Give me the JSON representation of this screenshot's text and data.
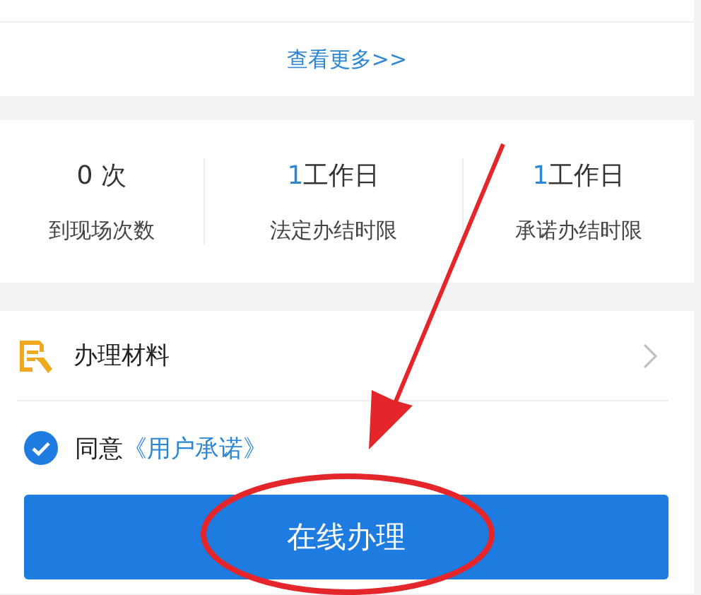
{
  "more_link": "查看更多>>",
  "stats": [
    {
      "number": "0",
      "unit": "次",
      "highlight": false,
      "label": "到现场次数"
    },
    {
      "number": "1",
      "unit": "工作日",
      "highlight": true,
      "label": "法定办结时限"
    },
    {
      "number": "1",
      "unit": "工作日",
      "highlight": true,
      "label": "承诺办结时限"
    }
  ],
  "materials": {
    "label": "办理材料"
  },
  "agreement": {
    "checked": true,
    "text": "同意",
    "link": "《用户承诺》"
  },
  "submit_button": "在线办理"
}
